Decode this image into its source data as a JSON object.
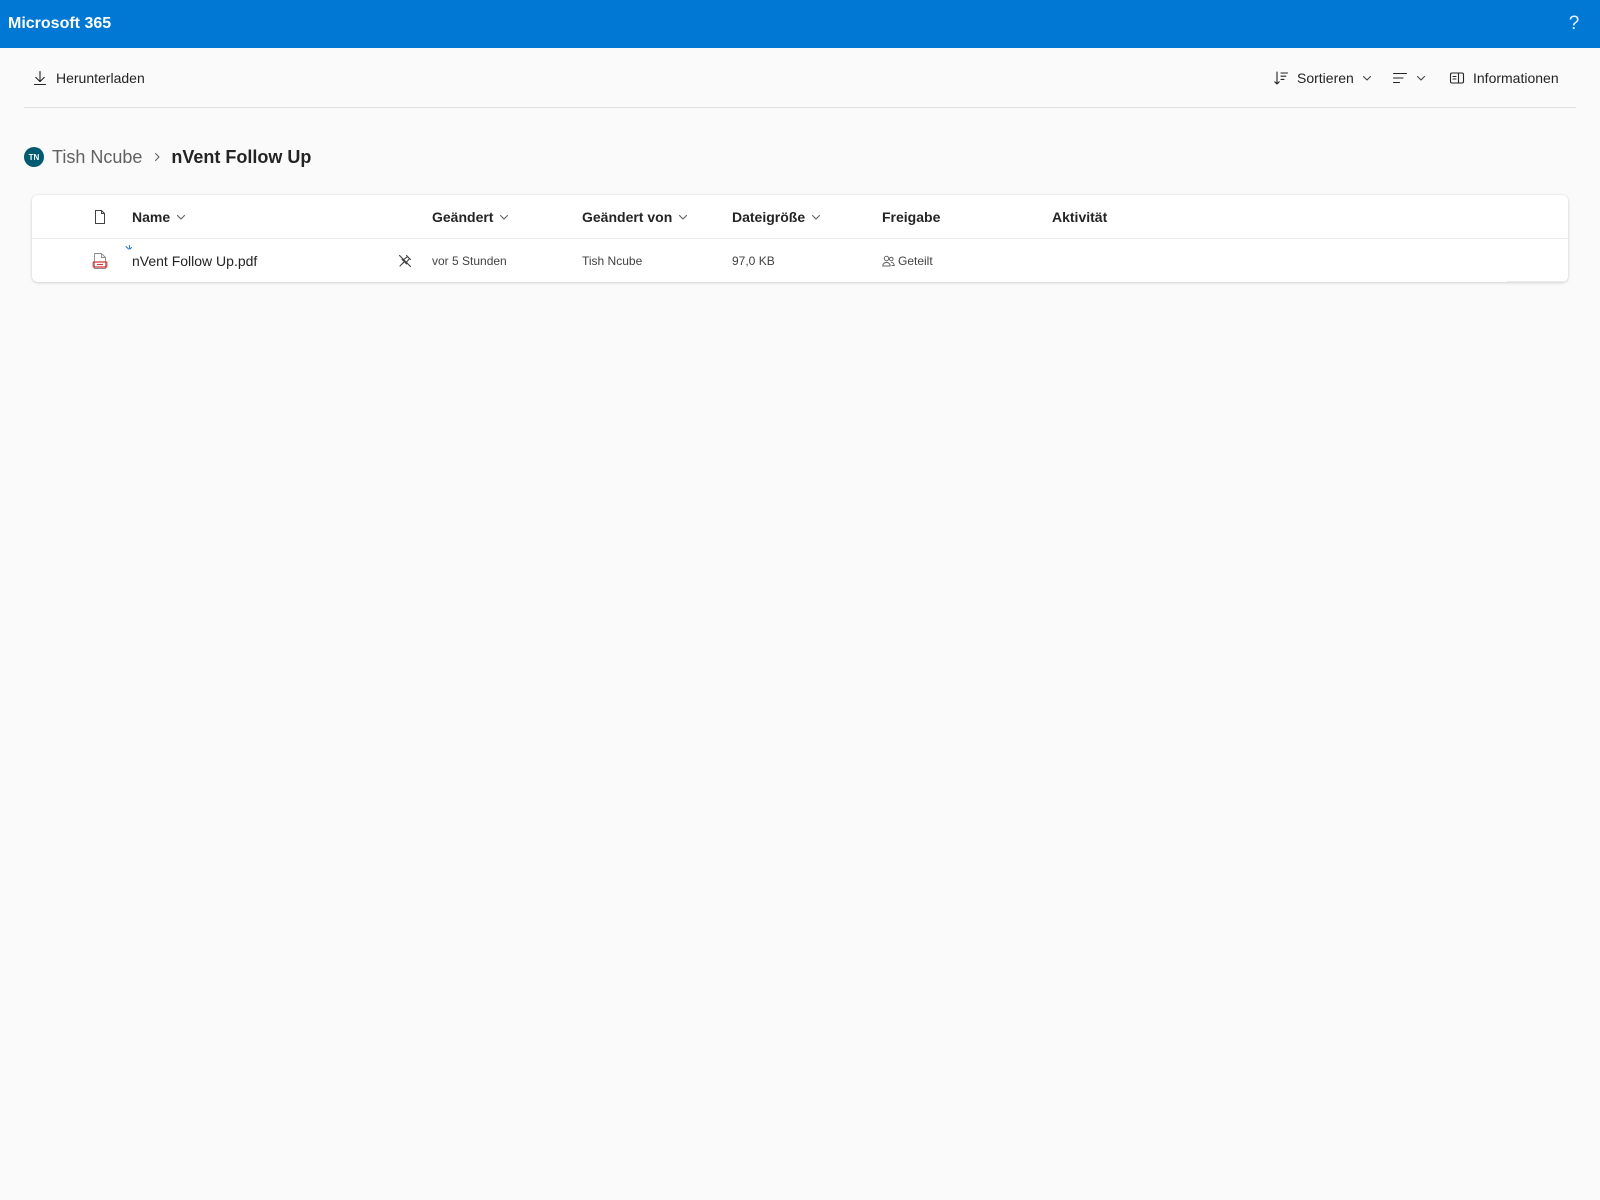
{
  "app": {
    "title": "Microsoft 365",
    "help_symbol": "?"
  },
  "colors": {
    "brand": "#0078d4",
    "avatar": "#005b70",
    "pdf_icon": "#d13438"
  },
  "commandbar": {
    "download_label": "Herunterladen",
    "sort_label": "Sortieren",
    "info_label": "Informationen"
  },
  "breadcrumb": {
    "avatar_initials": "TN",
    "parent": "Tish Ncube",
    "current": "nVent Follow Up"
  },
  "table": {
    "columns": {
      "name": "Name",
      "modified": "Geändert",
      "modified_by": "Geändert von",
      "size": "Dateigröße",
      "sharing": "Freigabe",
      "activity": "Aktivität"
    },
    "rows": [
      {
        "name": "nVent Follow Up.pdf",
        "icon": "pdf-file-icon",
        "modified": "vor 5 Stunden",
        "modified_by": "Tish Ncube",
        "size": "97,0 KB",
        "sharing": "Geteilt",
        "activity": ""
      }
    ]
  }
}
